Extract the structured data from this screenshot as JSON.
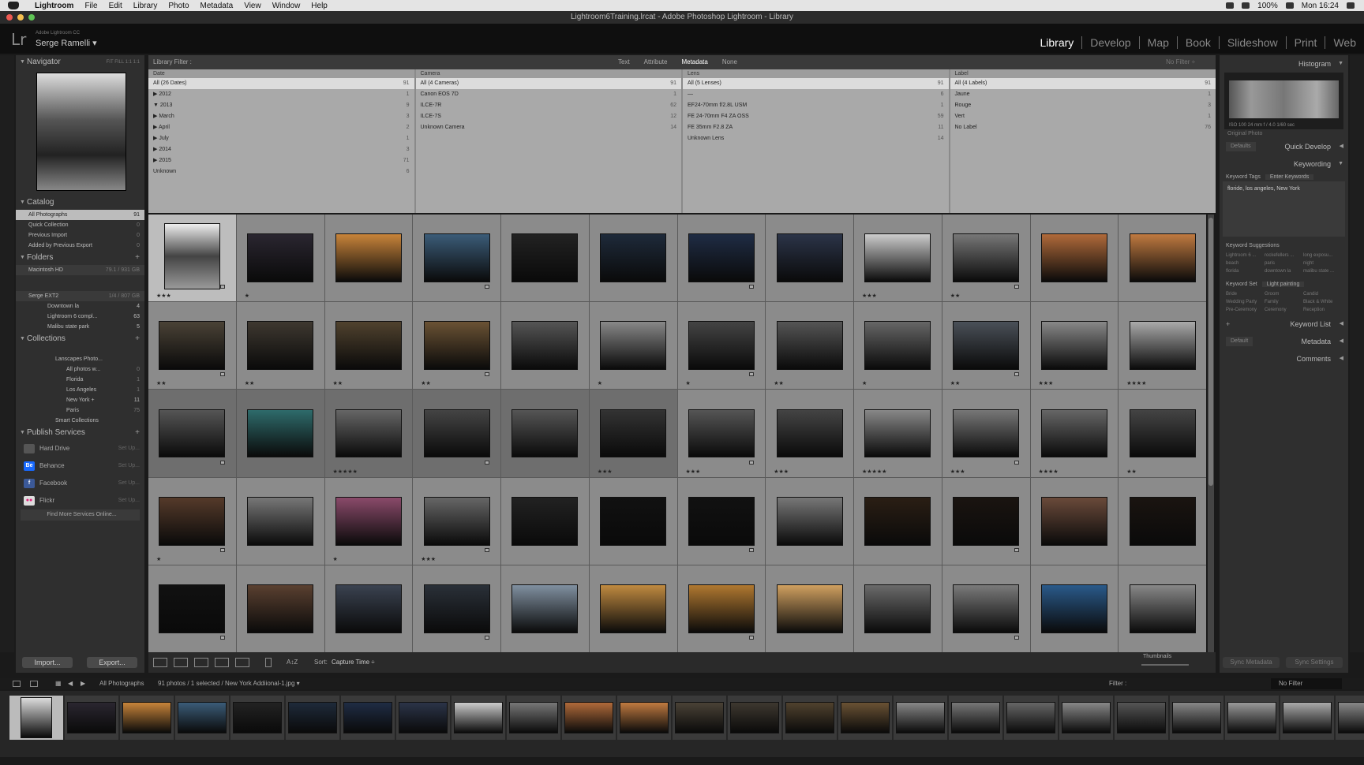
{
  "menubar": {
    "app": "Lightroom",
    "items": [
      "File",
      "Edit",
      "Library",
      "Photo",
      "Metadata",
      "View",
      "Window",
      "Help"
    ],
    "battery": "100%",
    "clock": "Mon 16:24"
  },
  "window": {
    "title": "Lightroom6Training.lrcat - Adobe Photoshop Lightroom - Library"
  },
  "identity": {
    "logo": "Lr",
    "product": "Adobe Lightroom CC",
    "user": "Serge Ramelli ▾"
  },
  "modules": [
    "Library",
    "Develop",
    "Map",
    "Book",
    "Slideshow",
    "Print",
    "Web"
  ],
  "left": {
    "navigator": "Navigator",
    "navigator_zoom": "FIT  FILL  1:1  1:1",
    "catalog": "Catalog",
    "catalog_items": [
      [
        "All Photographs",
        "91"
      ],
      [
        "Quick Collection",
        "0"
      ],
      [
        "Previous Import",
        "0"
      ],
      [
        "Added by Previous Export",
        "0"
      ]
    ],
    "folders": "Folders",
    "drive1": "Macintosh HD",
    "drive1_size": "79.1 / 931 GB",
    "drive2": "Serge EXT2",
    "drive2_size": "1/4 / 807 GB",
    "folder_items": [
      [
        "Downtown la",
        "4"
      ],
      [
        "Lightroom 6 compl...",
        "63"
      ],
      [
        "Malibu state park",
        "5"
      ]
    ],
    "collections": "Collections",
    "coll_items": [
      [
        "Lanscapes Photo...",
        ""
      ],
      [
        "All photos w...",
        "0"
      ],
      [
        "Florida",
        "1"
      ],
      [
        "Los Angeles",
        "1"
      ],
      [
        "New York +",
        "11"
      ],
      [
        "Paris",
        "75"
      ],
      [
        "Smart Collections",
        ""
      ]
    ],
    "publish": "Publish Services",
    "services": [
      [
        "Hard Drive",
        "Set Up..."
      ],
      [
        "Behance",
        "Set Up..."
      ],
      [
        "Facebook",
        "Set Up..."
      ],
      [
        "Flickr",
        "Set Up..."
      ]
    ],
    "find_more": "Find More Services Online...",
    "import": "Import...",
    "export": "Export..."
  },
  "filter": {
    "label": "Library Filter :",
    "tabs": [
      "Text",
      "Attribute",
      "Metadata",
      "None"
    ],
    "preset": "No Filter ÷"
  },
  "columns": [
    {
      "head": "Date",
      "rows": [
        [
          "All (26 Dates)",
          "91"
        ],
        [
          "▶ 2012",
          "1"
        ],
        [
          "▼ 2013",
          "9"
        ],
        [
          "   ▶ March",
          "3"
        ],
        [
          "   ▶ April",
          "2"
        ],
        [
          "   ▶ July",
          "1"
        ],
        [
          "▶ 2014",
          "3"
        ],
        [
          "▶ 2015",
          "71"
        ],
        [
          "Unknown",
          "6"
        ]
      ]
    },
    {
      "head": "Camera",
      "rows": [
        [
          "All (4 Cameras)",
          "91"
        ],
        [
          "Canon EOS 7D",
          "1"
        ],
        [
          "ILCE-7R",
          "62"
        ],
        [
          "ILCE-7S",
          "12"
        ],
        [
          "Unknown Camera",
          "14"
        ]
      ]
    },
    {
      "head": "Lens",
      "rows": [
        [
          "All (5 Lenses)",
          "91"
        ],
        [
          "—",
          "6"
        ],
        [
          "EF24-70mm f/2.8L USM",
          "1"
        ],
        [
          "FE 24-70mm F4 ZA OSS",
          "59"
        ],
        [
          "FE 35mm F2.8 ZA",
          "11"
        ],
        [
          "Unknown Lens",
          "14"
        ]
      ]
    },
    {
      "head": "Label",
      "rows": [
        [
          "All (4 Labels)",
          "91"
        ],
        [
          "Jaune",
          "1"
        ],
        [
          "Rouge",
          "3"
        ],
        [
          "Vert",
          "1"
        ],
        [
          "No Label",
          "76"
        ]
      ]
    }
  ],
  "grid": {
    "stars": [
      "★★★",
      "★",
      "",
      "",
      "",
      "",
      "",
      "",
      "★★★",
      "★★",
      "",
      "",
      "★★",
      "★★",
      "★★",
      "★★",
      "",
      "★",
      "★",
      "★★",
      "★",
      "★★",
      "★★★",
      "★★★★",
      "",
      "",
      "★★★★★",
      "",
      "",
      "★★★",
      "★★★",
      "★★★",
      "★★★★★",
      "★★★",
      "★★★★",
      "★★",
      "★",
      "",
      "★",
      "★★★",
      "",
      "",
      "",
      "",
      "",
      "",
      "",
      "",
      "",
      "",
      "",
      "",
      "",
      "",
      "",
      "",
      "",
      "",
      "",
      ""
    ]
  },
  "toolbar": {
    "sort_label": "Sort:",
    "sort_value": "Capture Time ÷",
    "thumbs": "Thumbnails"
  },
  "right": {
    "histogram": "Histogram",
    "hist_info": "ISO 100    24 mm    f / 4.0    1/60 sec",
    "original": "Original Photo",
    "quick": "Quick Develop",
    "defaults": "Defaults",
    "keywording": "Keywording",
    "kw_tags": "Keyword Tags",
    "kw_enter": "Enter Keywords",
    "kw_text": "floride, los angeles, New York",
    "kw_sugg": "Keyword Suggestions",
    "sugg": [
      "Lightroom 6 ...",
      "rockefellers ...",
      "long exposu...",
      "beach",
      "paris",
      "night",
      "florida",
      "downtown la",
      "malibu state ..."
    ],
    "kw_set": "Keyword Set",
    "kw_set_val": "Light painting",
    "set_items": [
      "Bride",
      "Groom",
      "Candid",
      "Wedding Party",
      "Family",
      "Black & White",
      "Pre-Ceremony",
      "Ceremony",
      "Reception"
    ],
    "kw_list": "Keyword List",
    "metadata": "Metadata",
    "meta_default": "Default",
    "comments": "Comments",
    "sync_meta": "Sync Metadata",
    "sync_settings": "Sync Settings"
  },
  "filmstrip": {
    "source": "All Photographs",
    "info": "91 photos / 1 selected / New York Addiional-1.jpg ▾",
    "filter": "Filter :",
    "filter_val": "No Filter"
  },
  "colors": {
    "panel": "#2f2f2f",
    "grid": "#8b8b8b",
    "selected": "#bdbdbd"
  }
}
